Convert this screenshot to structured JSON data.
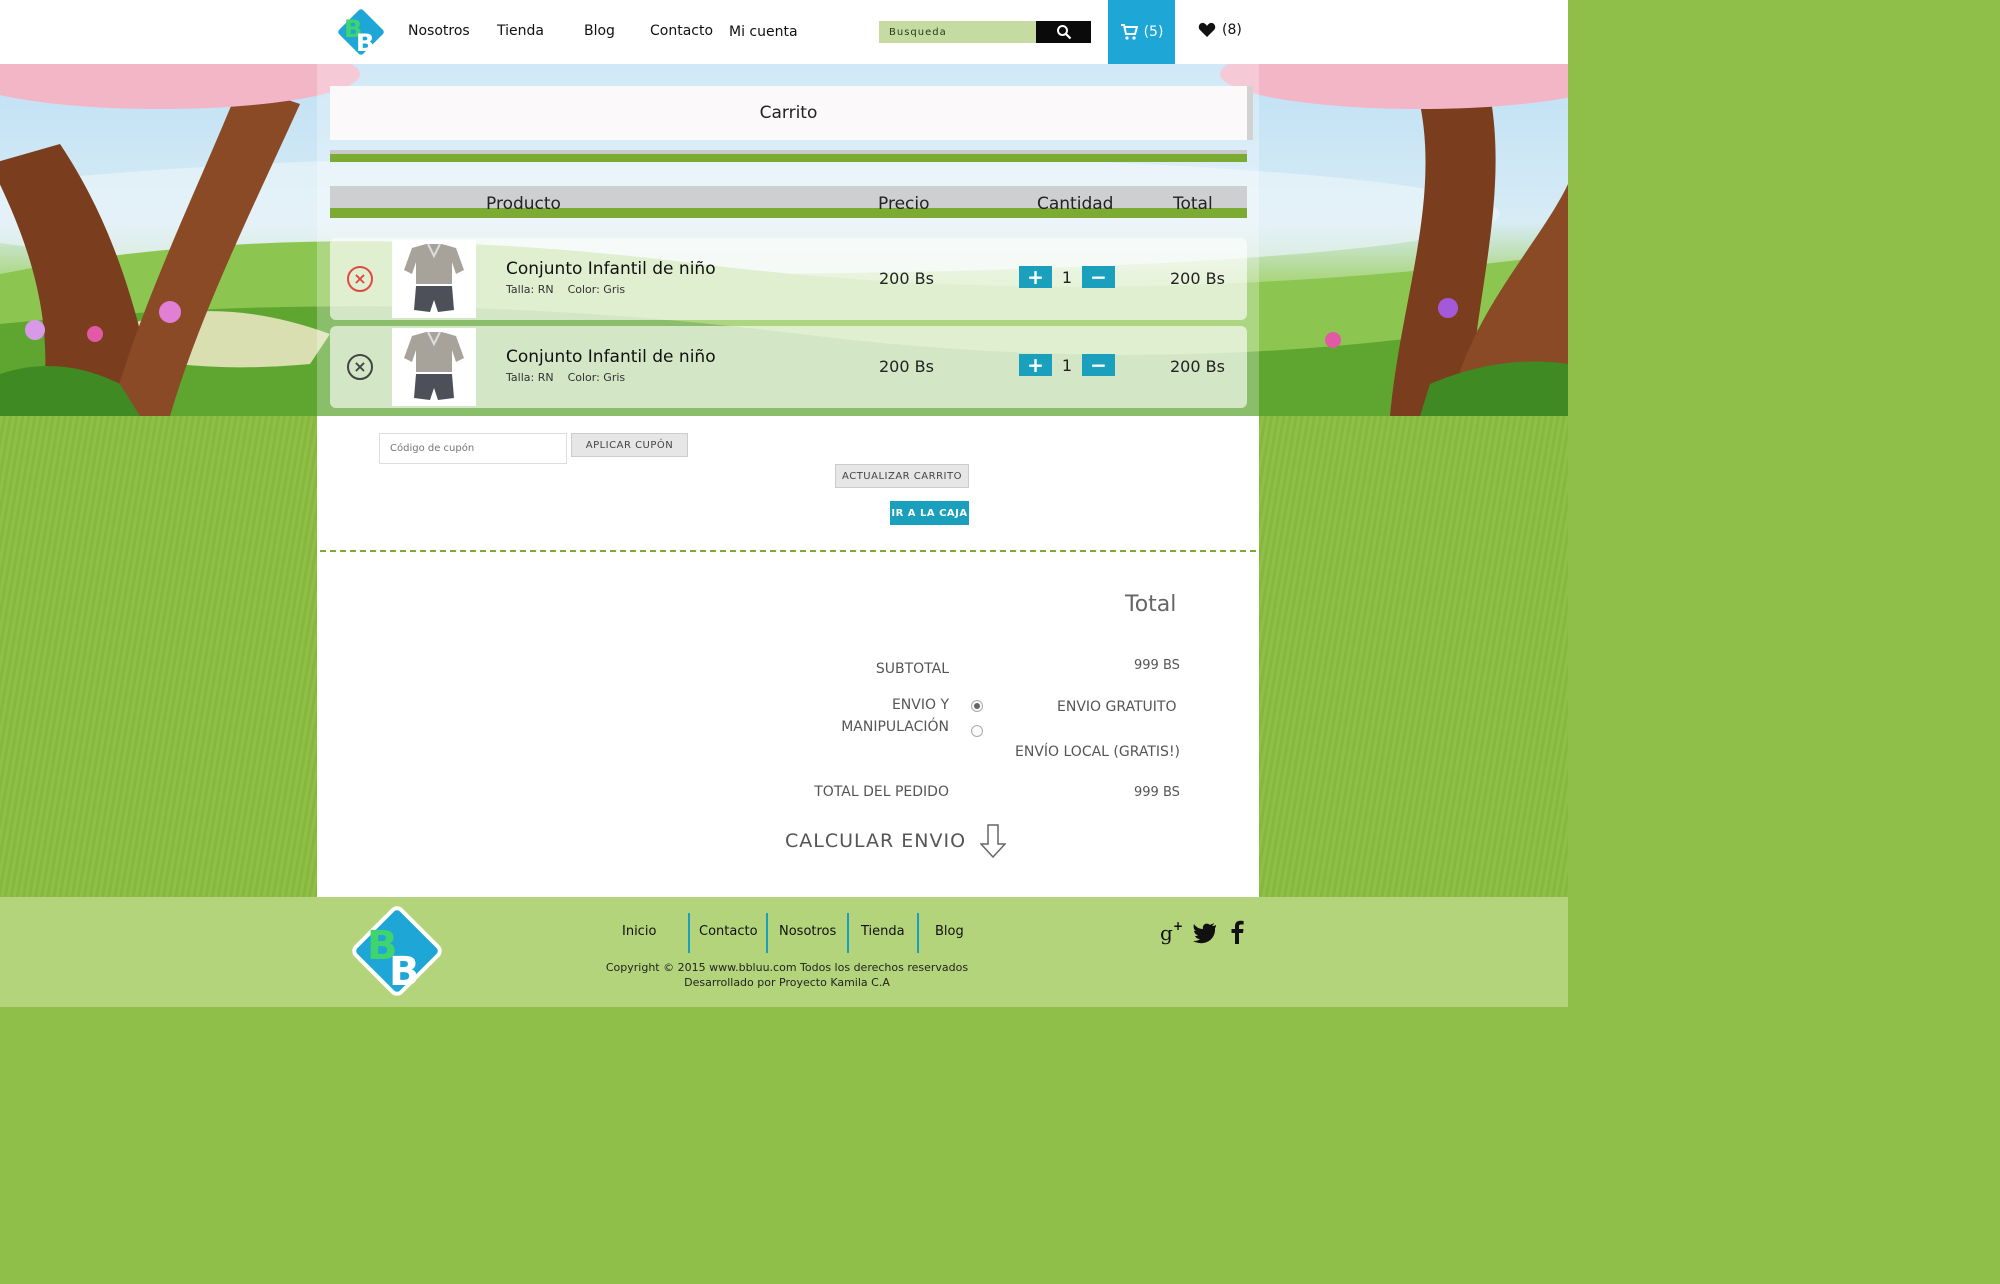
{
  "header": {
    "nav": [
      "Nosotros",
      "Tienda",
      "Blog",
      "Contacto",
      "Mi cuenta"
    ],
    "search_placeholder": "Busqueda",
    "cart_count": "(5)",
    "favorites_count": "(8)"
  },
  "cart": {
    "title": "Carrito",
    "columns": {
      "product": "Producto",
      "price": "Precio",
      "quantity": "Cantidad",
      "total": "Total"
    },
    "items": [
      {
        "name": "Conjunto Infantil de niño",
        "size": "Talla: RN",
        "color": "Color: Gris",
        "price": "200 Bs",
        "quantity": "1",
        "total": "200 Bs"
      },
      {
        "name": "Conjunto Infantil de niño",
        "size": "Talla: RN",
        "color": "Color: Gris",
        "price": "200 Bs",
        "quantity": "1",
        "total": "200 Bs"
      }
    ],
    "coupon_placeholder": "Código de cupón",
    "apply_coupon": "APLICAR CUPÓN",
    "update_cart": "ACTUALIZAR CARRITO",
    "checkout": "IR A LA CAJA"
  },
  "totals": {
    "heading": "Total",
    "subtotal_label": "SUBTOTAL",
    "subtotal_value": "999 BS",
    "shipping_label_1": "ENVIO Y",
    "shipping_label_2": "MANIPULACIÓN",
    "shipping_option_1": "ENVIO GRATUITO",
    "shipping_option_2": "ENVÍO LOCAL (GRATIS!)",
    "order_total_label": "TOTAL DEL PEDIDO",
    "order_total_value": "999 BS",
    "calculate_shipping": "CALCULAR ENVIO"
  },
  "footer": {
    "nav": [
      "Inicio",
      "Contacto",
      "Nosotros",
      "Tienda",
      "Blog"
    ],
    "copyright": "Copyright © 2015 www.bbluu.com Todos los derechos reservados",
    "developer": "Desarrollado por Proyecto Kamila C.A"
  },
  "colors": {
    "accent": "#1da6d6",
    "green": "#7cab34",
    "remove_active": "#e04848"
  },
  "icons": [
    "search-icon",
    "cart-icon",
    "heart-icon",
    "remove-icon",
    "plus-icon",
    "minus-icon",
    "arrow-down-icon",
    "google-plus-icon",
    "twitter-icon",
    "facebook-icon"
  ]
}
